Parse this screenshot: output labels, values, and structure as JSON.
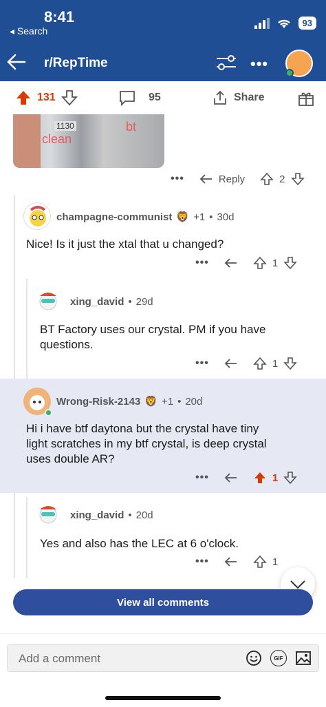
{
  "status_bar": {
    "time": "8:41",
    "back_label": "◂ Search",
    "battery": "93"
  },
  "nav": {
    "title": "r/RepTime"
  },
  "post_actions": {
    "upvotes": "131",
    "comments": "95",
    "share_label": "Share"
  },
  "photo": {
    "label_tag": "1130",
    "text_clean": "clean",
    "text_bt": "bt"
  },
  "op_actions": {
    "reply_label": "Reply",
    "score": "2"
  },
  "comments": [
    {
      "author": "champagne-communist",
      "flair": "+1",
      "age": "30d",
      "body": "Nice! Is it just the xtal that u changed?",
      "score": "1"
    },
    {
      "author": "xing_david",
      "age": "29d",
      "body_line1": "BT Factory uses our crystal. PM if you have",
      "body_line2": "questions.",
      "score": "1"
    },
    {
      "author": "Wrong-Risk-2143",
      "flair": "+1",
      "age": "20d",
      "body_line1": "Hi i have btf daytona but  the crystal have tiny",
      "body_line2": "light scratches in my btf crystal, is deep crystal",
      "body_line3": "uses double AR?",
      "score": "1"
    },
    {
      "author": "xing_david",
      "age": "20d",
      "body": "Yes and also has the LEC at 6 o'clock.",
      "score": "1"
    }
  ],
  "view_all_label": "View all comments",
  "composer": {
    "placeholder": "Add a comment",
    "gif_label": "GIF"
  },
  "colors": {
    "header": "#1f4e94",
    "upvote": "#d93a00",
    "highlight": "#e6e9f3",
    "button": "#2f4f9e"
  }
}
